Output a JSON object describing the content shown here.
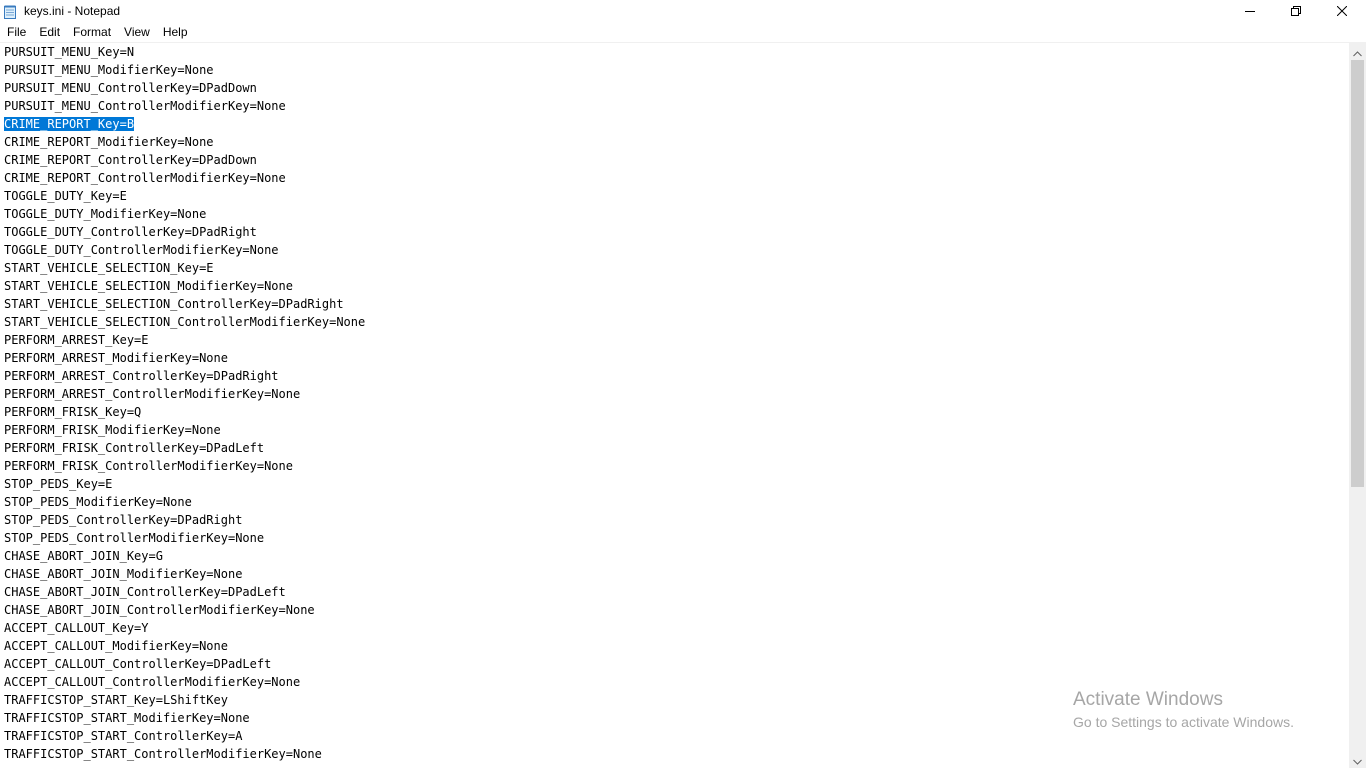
{
  "window": {
    "title": "keys.ini - Notepad",
    "icon": "notepad-icon",
    "controls": {
      "minimize": "minimize-icon",
      "maximize": "restore-icon",
      "close": "close-icon"
    }
  },
  "menu": [
    "File",
    "Edit",
    "Format",
    "View",
    "Help"
  ],
  "editor": {
    "selection": {
      "line": 4,
      "text": "CRIME_REPORT_Key=B"
    },
    "selection_color": "#0078d7",
    "lines": [
      "PURSUIT_MENU_Key=N",
      "PURSUIT_MENU_ModifierKey=None",
      "PURSUIT_MENU_ControllerKey=DPadDown",
      "PURSUIT_MENU_ControllerModifierKey=None",
      "CRIME_REPORT_Key=B",
      "CRIME_REPORT_ModifierKey=None",
      "CRIME_REPORT_ControllerKey=DPadDown",
      "CRIME_REPORT_ControllerModifierKey=None",
      "TOGGLE_DUTY_Key=E",
      "TOGGLE_DUTY_ModifierKey=None",
      "TOGGLE_DUTY_ControllerKey=DPadRight",
      "TOGGLE_DUTY_ControllerModifierKey=None",
      "START_VEHICLE_SELECTION_Key=E",
      "START_VEHICLE_SELECTION_ModifierKey=None",
      "START_VEHICLE_SELECTION_ControllerKey=DPadRight",
      "START_VEHICLE_SELECTION_ControllerModifierKey=None",
      "PERFORM_ARREST_Key=E",
      "PERFORM_ARREST_ModifierKey=None",
      "PERFORM_ARREST_ControllerKey=DPadRight",
      "PERFORM_ARREST_ControllerModifierKey=None",
      "PERFORM_FRISK_Key=Q",
      "PERFORM_FRISK_ModifierKey=None",
      "PERFORM_FRISK_ControllerKey=DPadLeft",
      "PERFORM_FRISK_ControllerModifierKey=None",
      "STOP_PEDS_Key=E",
      "STOP_PEDS_ModifierKey=None",
      "STOP_PEDS_ControllerKey=DPadRight",
      "STOP_PEDS_ControllerModifierKey=None",
      "CHASE_ABORT_JOIN_Key=G",
      "CHASE_ABORT_JOIN_ModifierKey=None",
      "CHASE_ABORT_JOIN_ControllerKey=DPadLeft",
      "CHASE_ABORT_JOIN_ControllerModifierKey=None",
      "ACCEPT_CALLOUT_Key=Y",
      "ACCEPT_CALLOUT_ModifierKey=None",
      "ACCEPT_CALLOUT_ControllerKey=DPadLeft",
      "ACCEPT_CALLOUT_ControllerModifierKey=None",
      "TRAFFICSTOP_START_Key=LShiftKey",
      "TRAFFICSTOP_START_ModifierKey=None",
      "TRAFFICSTOP_START_ControllerKey=A",
      "TRAFFICSTOP_START_ControllerModifierKey=None"
    ]
  },
  "scrollbar": {
    "up": "scroll-up-arrow-icon",
    "down": "scroll-down-arrow-icon"
  },
  "watermark": {
    "title": "Activate Windows",
    "subtitle": "Go to Settings to activate Windows."
  }
}
